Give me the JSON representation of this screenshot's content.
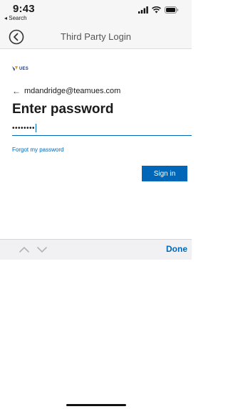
{
  "status": {
    "time": "9:43",
    "back_app": "◂ Search"
  },
  "navbar": {
    "title": "Third Party Login"
  },
  "brand": {
    "logo_text": "UES"
  },
  "login": {
    "account": "mdandridge@teamues.com",
    "heading": "Enter password",
    "password_value": "••••••••",
    "forgot": "Forgot my password",
    "signin": "Sign in"
  },
  "keyboard_toolbar": {
    "done": "Done"
  },
  "colors": {
    "accent": "#0067b8",
    "brand": "#1f3b82",
    "bar_bg": "#f6f6f6"
  },
  "icons": [
    "back-circle-icon",
    "signal-icon",
    "wifi-icon",
    "battery-icon",
    "left-arrow-icon",
    "chevron-up-icon",
    "chevron-down-icon"
  ]
}
